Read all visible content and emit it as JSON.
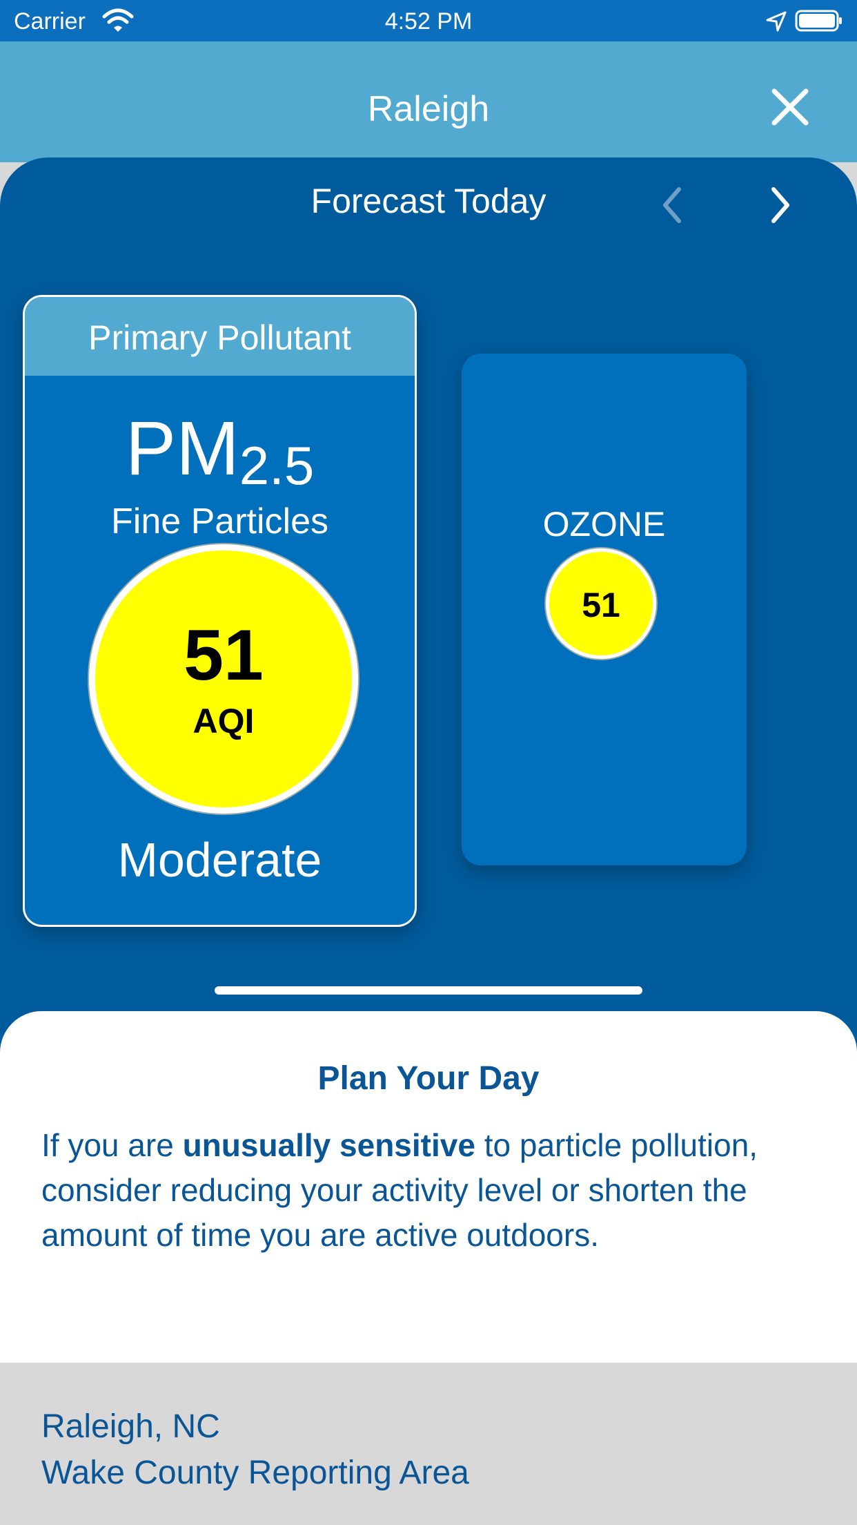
{
  "status_bar": {
    "carrier": "Carrier",
    "time": "4:52 PM",
    "icons": [
      "wifi-icon",
      "location-arrow-icon",
      "battery-icon"
    ]
  },
  "header": {
    "title": "Raleigh",
    "close_icon": "close-icon"
  },
  "forecast": {
    "title": "Forecast Today",
    "prev_icon": "chevron-left-icon",
    "next_icon": "chevron-right-icon"
  },
  "primary_card": {
    "label": "Primary Pollutant",
    "pollutant_main": "PM",
    "pollutant_sub": "2.5",
    "pollutant_name": "Fine Particles",
    "aqi_value": "51",
    "aqi_unit": "AQI",
    "category": "Moderate"
  },
  "secondary_card": {
    "pollutant": "OZONE",
    "aqi_value": "51"
  },
  "plan": {
    "title": "Plan Your Day",
    "text_before": "If you are ",
    "text_bold": "unusually sensitive",
    "text_after": " to particle pollution, consider reducing your activity level or shorten the amount of time you are active outdoors."
  },
  "reporting_area": {
    "city": "Raleigh, NC",
    "area": "Wake County Reporting Area"
  },
  "colors": {
    "status_bar": "#0b6fbd",
    "header": "#52aad0",
    "panel": "#005b9c",
    "card": "#0070bc",
    "aqi_moderate": "#ffff00",
    "text_dark_blue": "#0a5596"
  }
}
